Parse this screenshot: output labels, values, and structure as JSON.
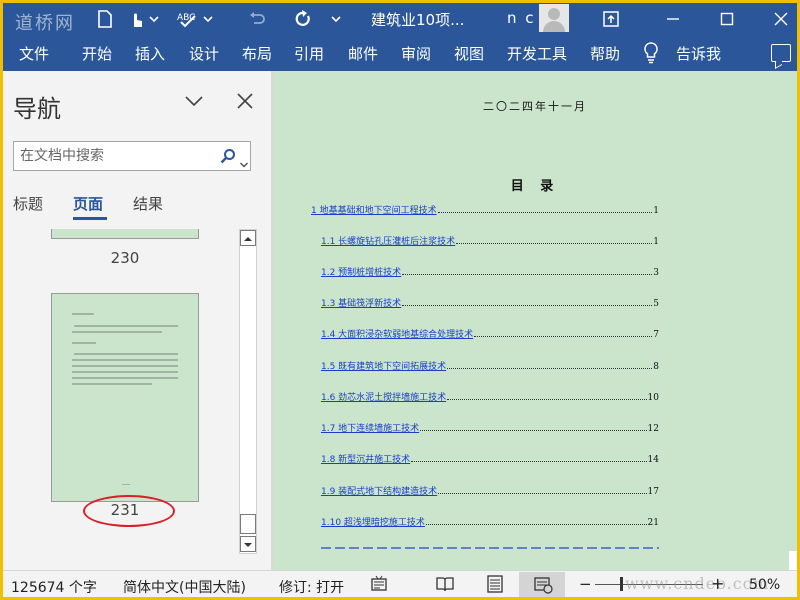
{
  "window": {
    "title": "建筑业10项...",
    "user_initials": "n c",
    "watermark_top": "道桥网"
  },
  "icons": {
    "quick_access": [
      "save-icon",
      "touch-mode-icon",
      "spelling-check-icon",
      "undo-icon",
      "redo-icon",
      "autosave-icon"
    ],
    "window_controls": [
      "ribbon-display-icon",
      "minimize-icon",
      "restore-icon",
      "close-icon"
    ]
  },
  "ribbon": {
    "tabs": [
      "文件",
      "开始",
      "插入",
      "设计",
      "布局",
      "引用",
      "邮件",
      "审阅",
      "视图",
      "开发工具",
      "帮助"
    ],
    "tell_me": "告诉我"
  },
  "navigation": {
    "title": "导航",
    "search_placeholder": "在文档中搜索",
    "tabs": [
      "标题",
      "页面",
      "结果"
    ],
    "active_tab": "页面",
    "pages": [
      {
        "number": "230"
      },
      {
        "number": "231",
        "highlighted": true
      }
    ]
  },
  "document": {
    "date": "二〇二四年十一月",
    "toc_title": "目 录",
    "toc": [
      {
        "text": "1  地基基础和地下空间工程技术",
        "page": "1",
        "level": 1
      },
      {
        "text": "1.1  长螺旋钻孔压灌桩后注浆技术",
        "page": "1",
        "level": 2
      },
      {
        "text": "1.2  预制桩增桩技术",
        "page": "3",
        "level": 2
      },
      {
        "text": "1.3  基础筏浮新技术",
        "page": "5",
        "level": 2
      },
      {
        "text": "1.4  大面积浸杂软弱地基综合处理技术",
        "page": "7",
        "level": 2
      },
      {
        "text": "1.5  既有建筑地下空间拓展技术",
        "page": "8",
        "level": 2
      },
      {
        "text": "1.6  劲芯水泥土搅拌墙施工技术",
        "page": "10",
        "level": 2
      },
      {
        "text": "1.7  地下连续墙施工技术",
        "page": "12",
        "level": 2
      },
      {
        "text": "1.8  新型沉井施工技术",
        "page": "14",
        "level": 2
      },
      {
        "text": "1.9  装配式地下结构建造技术",
        "page": "17",
        "level": 2
      },
      {
        "text": "1.10  超浅埋暗挖施工技术",
        "page": "21",
        "level": 2
      }
    ]
  },
  "statusbar": {
    "word_count": "125674 个字",
    "language": "简体中文(中国大陆)",
    "track_changes": "修订: 打开",
    "zoom": "50%",
    "watermark_bottom": "www.cndeo.com"
  },
  "colors": {
    "ribbon": "#2b579a",
    "page_background": "#cbe5cd",
    "link": "#1a3ec8",
    "highlight": "#d9202a",
    "border": "#f0c000"
  }
}
